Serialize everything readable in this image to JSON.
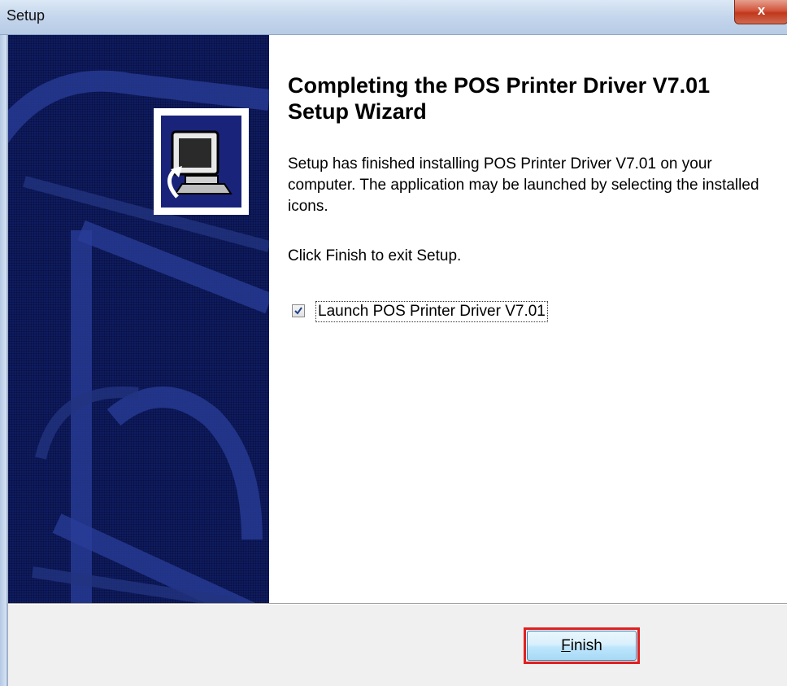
{
  "window": {
    "title": "Setup",
    "close_glyph": "x"
  },
  "wizard": {
    "heading": "Completing the POS Printer Driver V7.01 Setup Wizard",
    "body": "Setup has finished installing POS Printer Driver V7.01 on your computer. The application may be launched by selecting the installed icons.",
    "instruction": "Click Finish to exit Setup.",
    "launch_checkbox": {
      "label": "Launch POS Printer Driver V7.01",
      "checked": true
    }
  },
  "footer": {
    "finish_button": {
      "mnemonic": "F",
      "rest": "inish"
    }
  },
  "colors": {
    "banner": "#101e6a",
    "highlight": "#e02020"
  }
}
